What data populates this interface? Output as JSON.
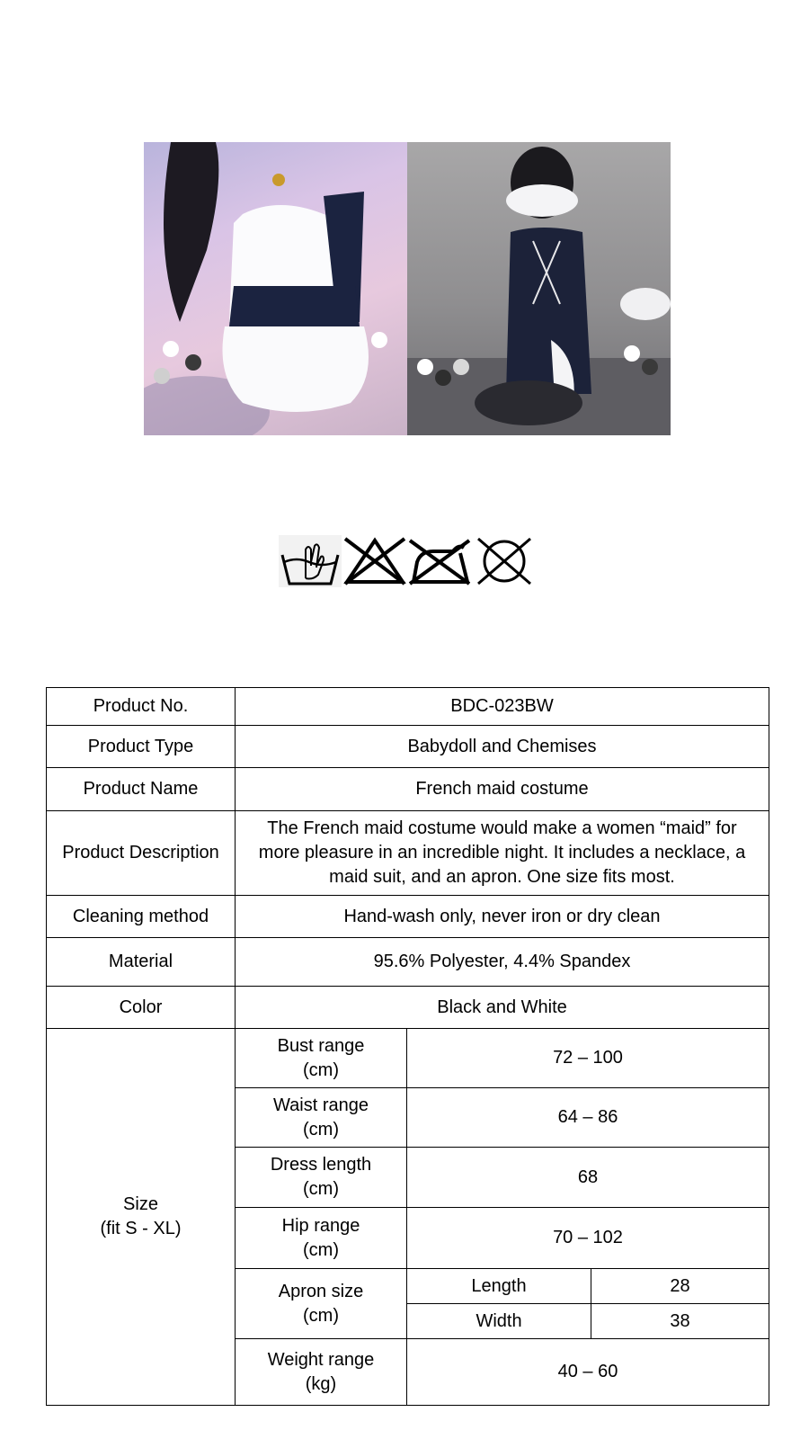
{
  "product": {
    "rows": [
      {
        "label": "Product No.",
        "value": "BDC-023BW"
      },
      {
        "label": "Product Type",
        "value": "Babydoll and Chemises"
      },
      {
        "label": "Product Name",
        "value": "French maid costume"
      },
      {
        "label": "Product Description",
        "value": "The French maid costume would make a women “maid” for more pleasure in an incredible night.  It includes a necklace, a maid suit, and an apron. One size fits most."
      },
      {
        "label": "Cleaning method",
        "value": "Hand-wash only, never iron or dry clean"
      },
      {
        "label": "Material",
        "value": "95.6% Polyester, 4.4% Spandex"
      },
      {
        "label": "Color",
        "value": "Black and White"
      }
    ],
    "size": {
      "label": "Size\n(fit S - XL)",
      "bust": {
        "label": "Bust range\n(cm)",
        "value": "72 – 100"
      },
      "waist": {
        "label": "Waist range\n(cm)",
        "value": "64 – 86"
      },
      "dress": {
        "label": "Dress length\n(cm)",
        "value": "68"
      },
      "hip": {
        "label": "Hip range\n(cm)",
        "value": "70 – 102"
      },
      "apron": {
        "label": "Apron size\n(cm)",
        "length_label": "Length",
        "length_value": "28",
        "width_label": "Width",
        "width_value": "38"
      },
      "weight": {
        "label": "Weight range\n(kg)",
        "value": "40 – 60"
      }
    }
  },
  "care_icons": [
    "hand-wash-icon",
    "no-bleach-icon",
    "no-iron-icon",
    "no-dry-clean-icon"
  ]
}
